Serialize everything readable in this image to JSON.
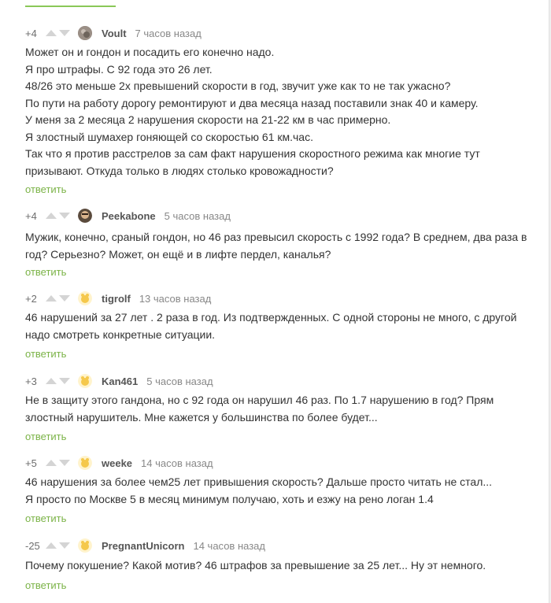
{
  "reply_label": "ответить",
  "colors": {
    "accent_green": "#8ac858",
    "reply_green": "#7bb347",
    "text": "#333333",
    "meta": "#888888"
  },
  "comments": [
    {
      "rating": "+4",
      "user": "Voult",
      "time": "7 часов назад",
      "avatar": "voult-avatar",
      "lines": [
        "Может он и гондон и посадить его конечно надо.",
        "Я про штрафы. С 92 года это 26 лет.",
        "48/26 это меньше 2х превышений скорости в год, звучит уже как то не так ужасно?",
        "По пути на работу дорогу ремонтируют и два месяца назад поставили знак 40 и камеру.",
        "У меня за 2 месяца 2 нарушения скорости на 21-22 км в час примерно.",
        "Я злостный шумахер гоняющей со скоростью 61 км.час.",
        "Так что я против расстрелов за сам факт нарушения скоростного режима как многие тут",
        "призывают. Откуда только в людях столько кровожадности?"
      ]
    },
    {
      "rating": "+4",
      "user": "Peekabone",
      "time": "5 часов назад",
      "avatar": "peekabone-avatar",
      "lines": [
        "Мужик, конечно, сраный гондон, но 46 раз превысил скорость с 1992 года? В среднем, два раза в",
        "год? Серьезно? Может, он ещё и в лифте пердел, каналья?"
      ]
    },
    {
      "rating": "+2",
      "user": "tigrolf",
      "time": "13 часов назад",
      "avatar": "default-avatar",
      "lines": [
        "46 нарушений за 27 лет . 2 раза в год. Из подтвержденных. С одной  стороны не много, с другой",
        "надо смотреть конкретные ситуации."
      ]
    },
    {
      "rating": "+3",
      "user": "Kan461",
      "time": "5 часов назад",
      "avatar": "default-avatar",
      "lines": [
        "Не в защиту этого гандона, но с 92 года он нарушил 46 раз. По 1.7 нарушению в год? Прям",
        "злостный нарушитель. Мне кажется у большинства по более будет..."
      ]
    },
    {
      "rating": "+5",
      "user": "weeke",
      "time": "14 часов назад",
      "avatar": "default-avatar",
      "lines": [
        "46 нарушения за более чем25 лет привышения скорость? Дальше просто читать не стал...",
        "Я просто по Москве 5 в месяц минимум получаю, хоть и езжу на рено логан 1.4"
      ]
    },
    {
      "rating": "-25",
      "user": "PregnantUnicorn",
      "time": "14 часов назад",
      "avatar": "default-avatar",
      "lines": [
        "Почему покушение? Какой мотив? 46 штрафов за превышение за 25 лет... Ну эт немного."
      ]
    }
  ]
}
